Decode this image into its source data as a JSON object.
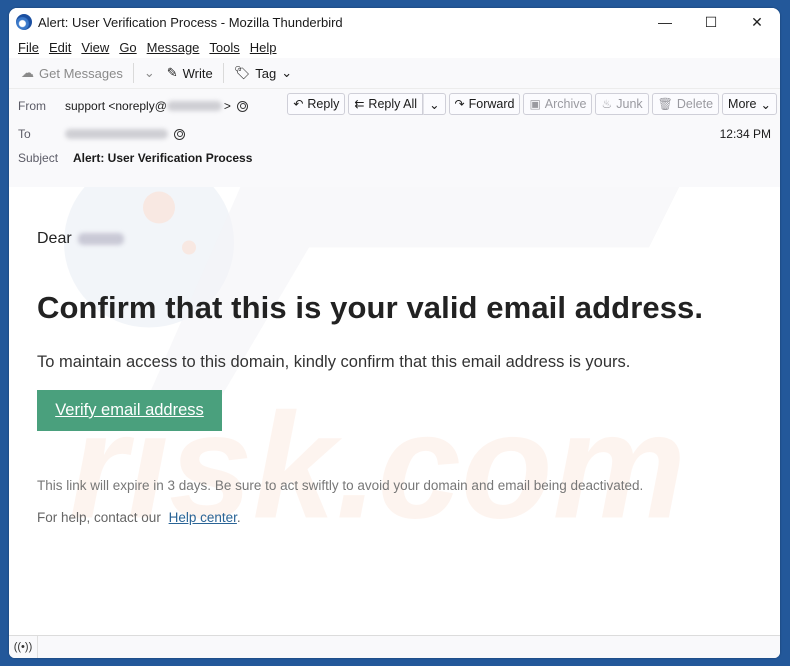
{
  "window": {
    "title": "Alert: User Verification Process - Mozilla Thunderbird",
    "controls": {
      "minimize": "—",
      "maximize": "☐",
      "close": "✕"
    }
  },
  "menubar": {
    "items": [
      {
        "label": "File",
        "accel": "F"
      },
      {
        "label": "Edit",
        "accel": "E"
      },
      {
        "label": "View",
        "accel": "V"
      },
      {
        "label": "Go",
        "accel": "G"
      },
      {
        "label": "Message",
        "accel": "M"
      },
      {
        "label": "Tools",
        "accel": "T"
      },
      {
        "label": "Help",
        "accel": "H"
      }
    ]
  },
  "toolbar": {
    "get_messages": "Get Messages",
    "write": "Write",
    "tag": "Tag"
  },
  "header": {
    "from_label": "From",
    "from_value": "support <noreply@",
    "from_suffix": ">",
    "to_label": "To",
    "subject_label": "Subject",
    "subject_value": "Alert: User Verification Process",
    "time": "12:34 PM",
    "actions": {
      "reply": "Reply",
      "reply_all": "Reply All",
      "forward": "Forward",
      "archive": "Archive",
      "junk": "Junk",
      "delete": "Delete",
      "more": "More"
    }
  },
  "email": {
    "greeting": "Dear",
    "headline": "Confirm that this is your valid email address.",
    "paragraph": "To maintain access to this domain, kindly confirm that this email address is yours.",
    "button": "Verify email address",
    "note": "This link will expire in 3 days. Be sure to act swiftly to avoid your domain and email being deactivated.",
    "help_prefix": "For help, contact our",
    "help_link": "Help center",
    "help_suffix": "."
  },
  "colors": {
    "accent_button": "#4aa07d",
    "link": "#2a6496",
    "desktop": "#23589a"
  }
}
